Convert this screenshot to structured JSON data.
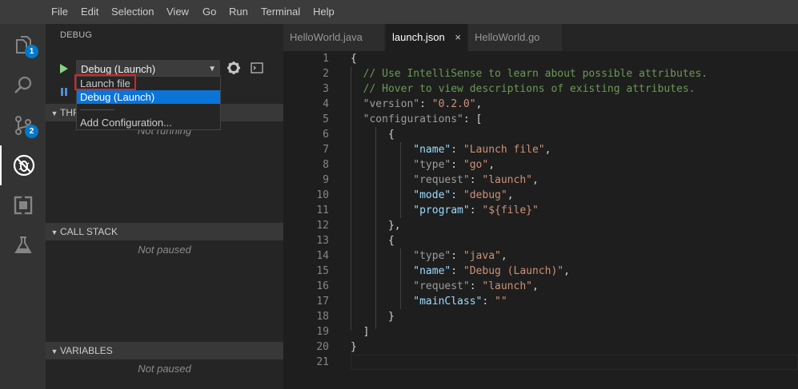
{
  "menubar": {
    "items": [
      "File",
      "Edit",
      "Selection",
      "View",
      "Go",
      "Run",
      "Terminal",
      "Help"
    ]
  },
  "activitybar": {
    "explorer_badge": "1",
    "scm_badge": "2",
    "icons": [
      "files-icon",
      "search-icon",
      "source-control-icon",
      "debug-icon",
      "extensions-icon",
      "flask-icon"
    ]
  },
  "sidebar": {
    "title": "DEBUG",
    "config_selected": "Debug (Launch)",
    "threads_header": "THREADS",
    "threads_msg": "Not running",
    "call_stack_header": "CALL STACK",
    "call_stack_msg": "Not paused",
    "variables_header": "VARIABLES",
    "variables_msg": "Not paused"
  },
  "dropdown": {
    "options": [
      "Launch file",
      "Debug (Launch)"
    ],
    "separator": "---------------------",
    "add_config": "Add Configuration...",
    "selected_index": 1
  },
  "tabs": [
    {
      "label": "HelloWorld.java",
      "active": false
    },
    {
      "label": "launch.json",
      "active": true
    },
    {
      "label": "HelloWorld.go",
      "active": false
    }
  ],
  "tab_close_glyph": "×",
  "editor": {
    "line_numbers": [
      "1",
      "2",
      "3",
      "4",
      "5",
      "6",
      "7",
      "8",
      "9",
      "10",
      "11",
      "12",
      "13",
      "14",
      "15",
      "16",
      "17",
      "18",
      "19",
      "20",
      "21"
    ],
    "lines": [
      [
        {
          "c": "t-punc",
          "t": "{"
        }
      ],
      [
        {
          "c": "t-com",
          "t": "  // Use IntelliSense to learn about possible attributes."
        }
      ],
      [
        {
          "c": "t-com",
          "t": "  // Hover to view descriptions of existing attributes."
        }
      ],
      [
        {
          "c": "t-keyd",
          "t": "  \"version\""
        },
        {
          "c": "t-punc",
          "t": ": "
        },
        {
          "c": "t-str",
          "t": "\"0.2.0\""
        },
        {
          "c": "t-punc",
          "t": ","
        }
      ],
      [
        {
          "c": "t-keyd",
          "t": "  \"configurations\""
        },
        {
          "c": "t-punc",
          "t": ": ["
        }
      ],
      [
        {
          "c": "t-punc",
          "t": "      {"
        }
      ],
      [
        {
          "c": "t-key",
          "t": "          \"name\""
        },
        {
          "c": "t-punc",
          "t": ": "
        },
        {
          "c": "t-str",
          "t": "\"Launch file\""
        },
        {
          "c": "t-punc",
          "t": ","
        }
      ],
      [
        {
          "c": "t-keyd",
          "t": "          \"type\""
        },
        {
          "c": "t-punc",
          "t": ": "
        },
        {
          "c": "t-str",
          "t": "\"go\""
        },
        {
          "c": "t-punc",
          "t": ","
        }
      ],
      [
        {
          "c": "t-keyd",
          "t": "          \"request\""
        },
        {
          "c": "t-punc",
          "t": ": "
        },
        {
          "c": "t-str",
          "t": "\"launch\""
        },
        {
          "c": "t-punc",
          "t": ","
        }
      ],
      [
        {
          "c": "t-key",
          "t": "          \"mode\""
        },
        {
          "c": "t-punc",
          "t": ": "
        },
        {
          "c": "t-str",
          "t": "\"debug\""
        },
        {
          "c": "t-punc",
          "t": ","
        }
      ],
      [
        {
          "c": "t-key",
          "t": "          \"program\""
        },
        {
          "c": "t-punc",
          "t": ": "
        },
        {
          "c": "t-str",
          "t": "\"${file}\""
        }
      ],
      [
        {
          "c": "t-punc",
          "t": "      },"
        }
      ],
      [
        {
          "c": "t-punc",
          "t": "      {"
        }
      ],
      [
        {
          "c": "t-keyd",
          "t": "          \"type\""
        },
        {
          "c": "t-punc",
          "t": ": "
        },
        {
          "c": "t-str",
          "t": "\"java\""
        },
        {
          "c": "t-punc",
          "t": ","
        }
      ],
      [
        {
          "c": "t-key",
          "t": "          \"name\""
        },
        {
          "c": "t-punc",
          "t": ": "
        },
        {
          "c": "t-str",
          "t": "\"Debug (Launch)\""
        },
        {
          "c": "t-punc",
          "t": ","
        }
      ],
      [
        {
          "c": "t-keyd",
          "t": "          \"request\""
        },
        {
          "c": "t-punc",
          "t": ": "
        },
        {
          "c": "t-str",
          "t": "\"launch\""
        },
        {
          "c": "t-punc",
          "t": ","
        }
      ],
      [
        {
          "c": "t-key",
          "t": "          \"mainClass\""
        },
        {
          "c": "t-punc",
          "t": ": "
        },
        {
          "c": "t-str",
          "t": "\"\""
        }
      ],
      [
        {
          "c": "t-punc",
          "t": "      }"
        }
      ],
      [
        {
          "c": "t-punc",
          "t": "  ]"
        }
      ],
      [
        {
          "c": "t-punc",
          "t": "}"
        }
      ],
      []
    ]
  },
  "colors": {
    "accent": "#007acc",
    "play": "#89d185",
    "highlight_box": "#e02020",
    "selection": "#0b74d8"
  }
}
